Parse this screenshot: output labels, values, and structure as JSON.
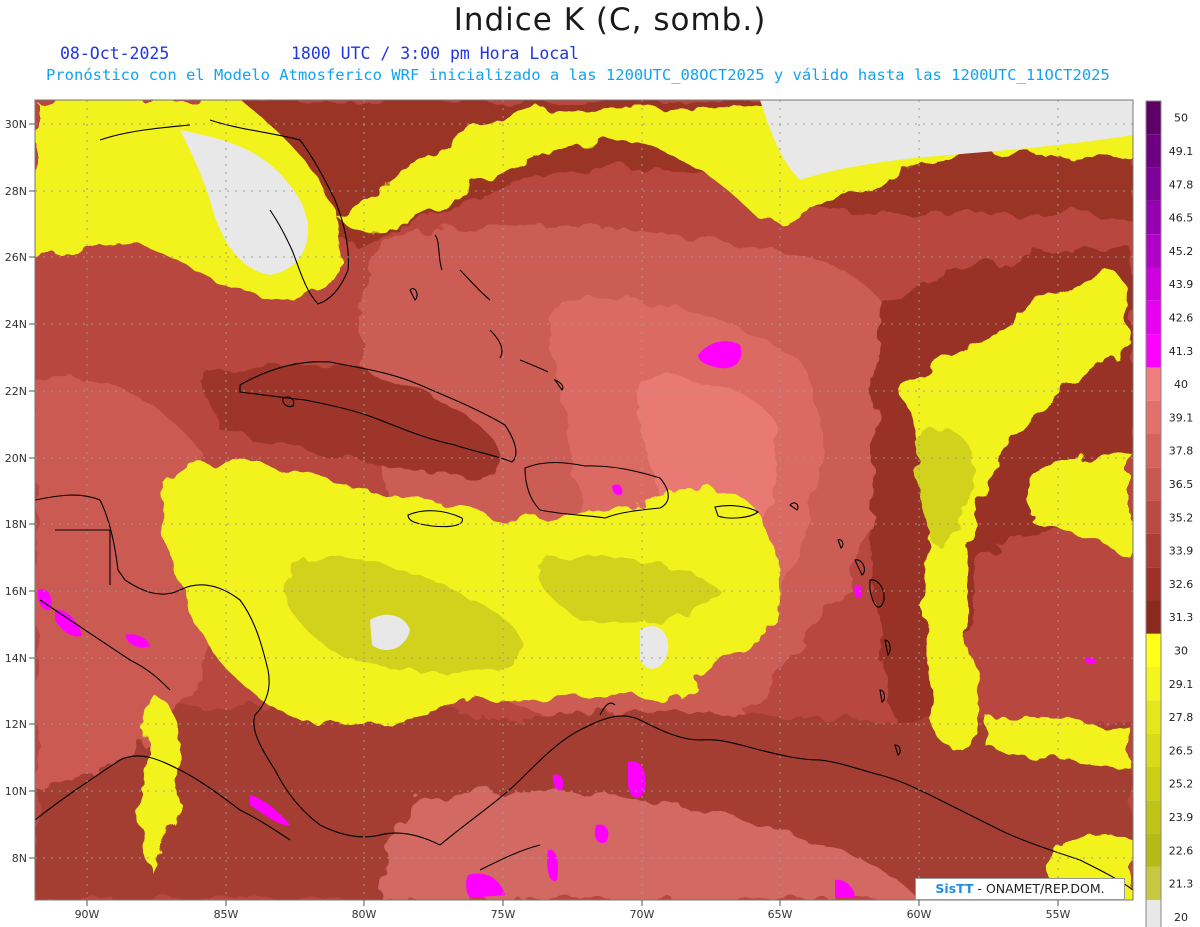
{
  "header": {
    "title": "Indice K (C, somb.)",
    "date": "08-Oct-2025",
    "time": "1800 UTC / 3:00 pm Hora Local",
    "forecast_note": "Pronóstico con el Modelo Atmosferico WRF inicializado a las 1200UTC_08OCT2025 y válido hasta las  1200UTC_11OCT2025"
  },
  "map": {
    "lon_ticks": [
      "90W",
      "85W",
      "80W",
      "75W",
      "70W",
      "65W",
      "60W",
      "55W"
    ],
    "lat_ticks": [
      "30N",
      "28N",
      "26N",
      "24N",
      "22N",
      "20N",
      "18N",
      "16N",
      "14N",
      "12N",
      "10N",
      "8N"
    ]
  },
  "colorbar": {
    "labels": [
      "50",
      "49.1",
      "47.8",
      "46.5",
      "45.2",
      "43.9",
      "42.6",
      "41.3",
      "40",
      "39.1",
      "37.8",
      "36.5",
      "35.2",
      "33.9",
      "32.6",
      "31.3",
      "30",
      "29.1",
      "27.8",
      "26.5",
      "25.2",
      "23.9",
      "22.6",
      "21.3",
      "20"
    ],
    "colors": [
      "#5f0068",
      "#6d0080",
      "#7f0098",
      "#9500b0",
      "#b000c8",
      "#cf00e0",
      "#e800f0",
      "#ff00ff",
      "#f07d7d",
      "#e4706d",
      "#d7635f",
      "#ca5752",
      "#bb4a44",
      "#ab3d37",
      "#9b312a",
      "#8a2a1d",
      "#ffff1a",
      "#f4f41f",
      "#e6e61c",
      "#d9da1a",
      "#cccf18",
      "#c0c416",
      "#b5ba14",
      "#c8c842",
      "#e8e8e8"
    ]
  },
  "credit": {
    "brand": "SisTT",
    "text": " - ONAMET/REP.DOM."
  },
  "colors": {
    "land_line": "#000000",
    "no_data": "#e8e8e8",
    "grid": "#9a9a9a"
  }
}
